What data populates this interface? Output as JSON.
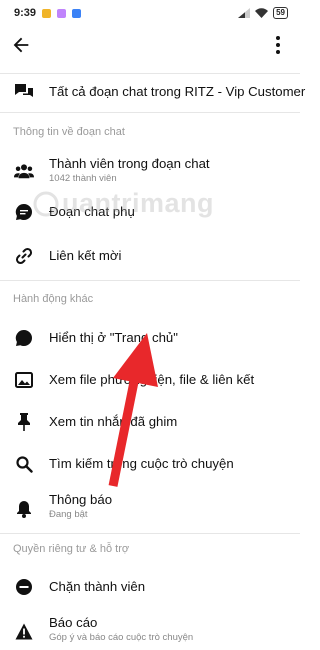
{
  "status_bar": {
    "time": "9:39",
    "battery": "59",
    "app_colors": [
      "#f0b429",
      "#c084fc",
      "#3b82f6"
    ]
  },
  "header": {
    "back_icon": "arrow-left-icon",
    "more_icon": "more-vertical-icon"
  },
  "top_item": {
    "label": "Tất cả đoạn chat trong RITZ - Vip Customer",
    "icon": "chat-bubbles-icon"
  },
  "sections": [
    {
      "title": "Thông tin về đoạn chat",
      "items": [
        {
          "label": "Thành viên trong đoạn chat",
          "sub": "1042 thành viên",
          "icon": "people-icon"
        },
        {
          "label": "Đoạn chat phụ",
          "icon": "chat-thread-icon"
        },
        {
          "label": "Liên kết mời",
          "icon": "link-icon"
        }
      ]
    },
    {
      "title": "Hành động khác",
      "items": [
        {
          "label": "Hiển thị ở \"Trang chủ\"",
          "icon": "chat-bubble-icon"
        },
        {
          "label": "Xem file phương tiện, file & liên kết",
          "icon": "image-icon"
        },
        {
          "label": "Xem tin nhắn đã ghim",
          "icon": "pin-icon"
        },
        {
          "label": "Tìm kiếm trong cuộc trò chuyện",
          "icon": "search-icon"
        },
        {
          "label": "Thông báo",
          "sub": "Đang bật",
          "icon": "bell-icon"
        }
      ]
    },
    {
      "title": "Quyền riêng tư & hỗ trợ",
      "items": [
        {
          "label": "Chặn thành viên",
          "icon": "block-icon"
        },
        {
          "label": "Báo cáo",
          "sub": "Góp ý và báo cáo cuộc trò chuyện",
          "icon": "warning-icon"
        }
      ]
    }
  ],
  "watermark": "uantrimang",
  "accent_color": "#e8282b"
}
